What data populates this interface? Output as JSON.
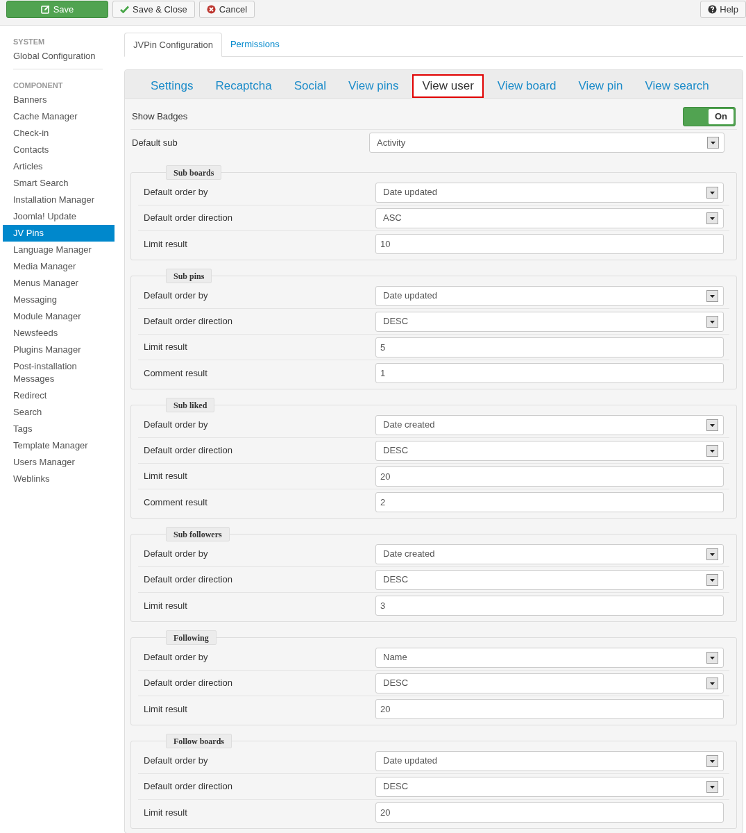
{
  "toolbar": {
    "buttons": [
      {
        "label": "Save",
        "kind": "primary"
      },
      {
        "label": "Save & Close",
        "kind": "default"
      },
      {
        "label": "Cancel",
        "kind": "default"
      }
    ],
    "help": {
      "label": "Help"
    }
  },
  "sidebar": {
    "sections": [
      {
        "heading": "SYSTEM",
        "items": [
          {
            "label": "Global Configuration",
            "selected": false
          }
        ]
      },
      {
        "heading": "COMPONENT",
        "items": [
          {
            "label": "Banners",
            "selected": false
          },
          {
            "label": "Cache Manager",
            "selected": false
          },
          {
            "label": "Check-in",
            "selected": false
          },
          {
            "label": "Contacts",
            "selected": false
          },
          {
            "label": "Articles",
            "selected": false
          },
          {
            "label": "Smart Search",
            "selected": false
          },
          {
            "label": "Installation Manager",
            "selected": false
          },
          {
            "label": "Joomla! Update",
            "selected": false
          },
          {
            "label": "JV Pins",
            "selected": true
          },
          {
            "label": "Language Manager",
            "selected": false
          },
          {
            "label": "Media Manager",
            "selected": false
          },
          {
            "label": "Menus Manager",
            "selected": false
          },
          {
            "label": "Messaging",
            "selected": false
          },
          {
            "label": "Module Manager",
            "selected": false
          },
          {
            "label": "Newsfeeds",
            "selected": false
          },
          {
            "label": "Plugins Manager",
            "selected": false
          },
          {
            "label": "Post-installation Messages",
            "selected": false
          },
          {
            "label": "Redirect",
            "selected": false
          },
          {
            "label": "Search",
            "selected": false
          },
          {
            "label": "Tags",
            "selected": false
          },
          {
            "label": "Template Manager",
            "selected": false
          },
          {
            "label": "Users Manager",
            "selected": false
          },
          {
            "label": "Weblinks",
            "selected": false
          }
        ]
      }
    ]
  },
  "page_tabs": [
    {
      "label": "JVPin Configuration",
      "selected": true
    },
    {
      "label": "Permissions",
      "selected": false
    }
  ],
  "view_tabs": [
    {
      "label": "Settings",
      "selected": false
    },
    {
      "label": "Recaptcha",
      "selected": false
    },
    {
      "label": "Social",
      "selected": false
    },
    {
      "label": "View pins",
      "selected": false
    },
    {
      "label": "View user",
      "selected": true
    },
    {
      "label": "View board",
      "selected": false
    },
    {
      "label": "View pin",
      "selected": false
    },
    {
      "label": "View search",
      "selected": false
    }
  ],
  "fields": [
    {
      "kind": "toggle",
      "label": "Show Badges",
      "on": true,
      "value": "On"
    },
    {
      "kind": "select",
      "label": "Default sub",
      "value": "Activity"
    }
  ],
  "groups": [
    {
      "legend": "Sub boards",
      "fields": [
        {
          "kind": "select",
          "label": "Default order by",
          "value": "Date updated"
        },
        {
          "kind": "select",
          "label": "Default order direction",
          "value": "ASC"
        },
        {
          "kind": "text",
          "label": "Limit result",
          "value": "10"
        }
      ]
    },
    {
      "legend": "Sub pins",
      "fields": [
        {
          "kind": "select",
          "label": "Default order by",
          "value": "Date updated"
        },
        {
          "kind": "select",
          "label": "Default order direction",
          "value": "DESC"
        },
        {
          "kind": "text",
          "label": "Limit result",
          "value": "5"
        },
        {
          "kind": "text",
          "label": "Comment result",
          "value": "1"
        }
      ]
    },
    {
      "legend": "Sub liked",
      "fields": [
        {
          "kind": "select",
          "label": "Default order by",
          "value": "Date created"
        },
        {
          "kind": "select",
          "label": "Default order direction",
          "value": "DESC"
        },
        {
          "kind": "text",
          "label": "Limit result",
          "value": "20"
        },
        {
          "kind": "text",
          "label": "Comment result",
          "value": "2"
        }
      ]
    },
    {
      "legend": "Sub followers",
      "fields": [
        {
          "kind": "select",
          "label": "Default order by",
          "value": "Date created"
        },
        {
          "kind": "select",
          "label": "Default order direction",
          "value": "DESC"
        },
        {
          "kind": "text",
          "label": "Limit result",
          "value": "3"
        }
      ]
    },
    {
      "legend": "Following",
      "fields": [
        {
          "kind": "select",
          "label": "Default order by",
          "value": "Name"
        },
        {
          "kind": "select",
          "label": "Default order direction",
          "value": "DESC"
        },
        {
          "kind": "text",
          "label": "Limit result",
          "value": "20"
        }
      ]
    },
    {
      "legend": "Follow boards",
      "fields": [
        {
          "kind": "select",
          "label": "Default order by",
          "value": "Date updated"
        },
        {
          "kind": "select",
          "label": "Default order direction",
          "value": "DESC"
        },
        {
          "kind": "text",
          "label": "Limit result",
          "value": "20"
        }
      ]
    }
  ]
}
